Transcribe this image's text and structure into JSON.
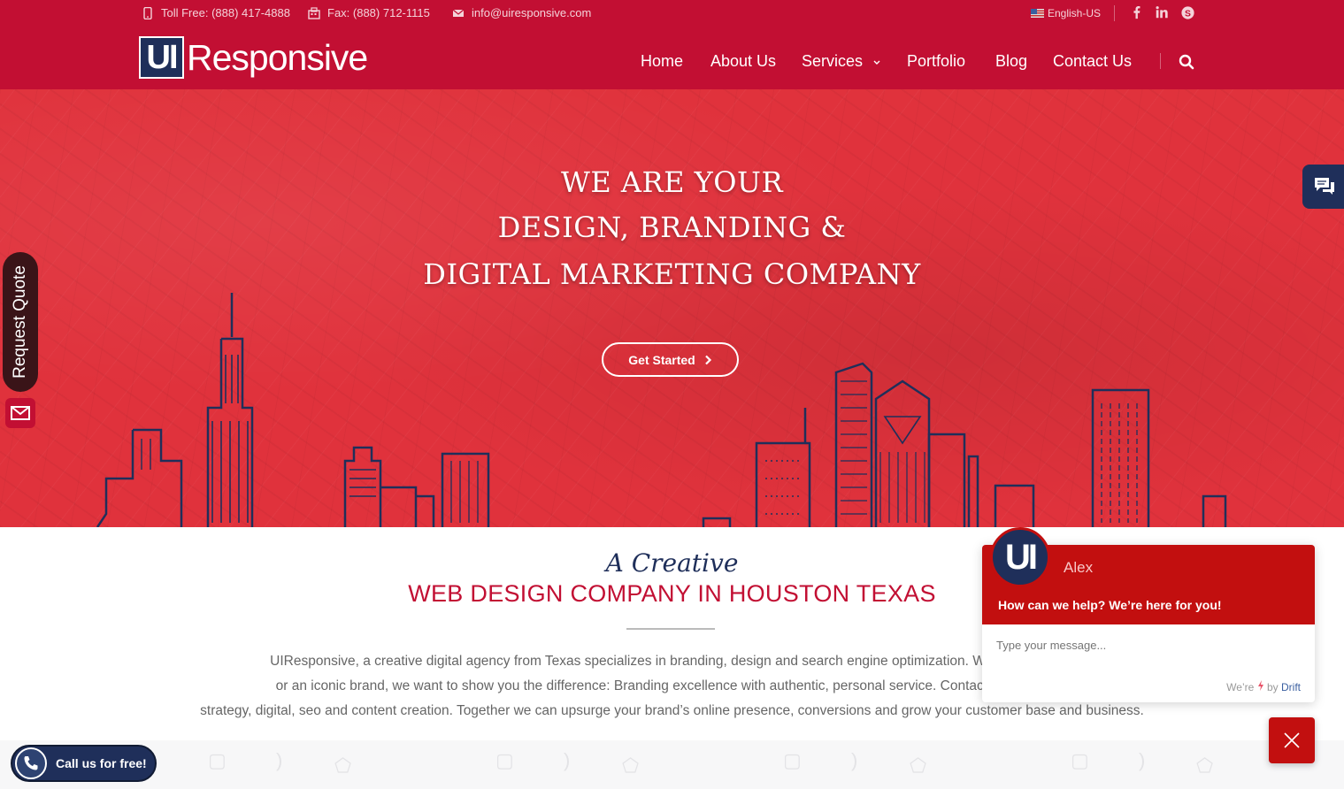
{
  "topbar": {
    "toll_free": "Toll Free: (888) 417-4888",
    "fax": "Fax: (888) 712-1115",
    "email": "info@uiresponsive.com",
    "language": "English-US"
  },
  "logo": {
    "mark": "UI",
    "text": "Responsive"
  },
  "nav": {
    "items": [
      "Home",
      "About Us",
      "Services",
      "Portfolio",
      "Blog",
      "Contact Us"
    ]
  },
  "hero": {
    "line1": "WE ARE YOUR",
    "line2": "DESIGN, BRANDING &",
    "line3": "DIGITAL MARKETING COMPANY",
    "cta": "Get Started"
  },
  "side": {
    "request_quote": "Request Quote"
  },
  "intro": {
    "heading_italic": "A Creative",
    "heading_main": "WEB DESIGN COMPANY IN HOUSTON TEXAS",
    "lines": [
      "UIResponsive, a creative digital agency from Texas specializes in branding, design and search engine optimization. Whether you are",
      "or an iconic brand, we want to show you the difference: Branding excellence with authentic, personal service. Contact our team tod",
      "strategy, digital, seo and content creation. Together we can upsurge your brand’s online presence, conversions and grow your customer base and business."
    ]
  },
  "call": {
    "label": "Call us for free!"
  },
  "drift": {
    "avatar": "UI",
    "agent_name": "Alex",
    "welcome": "How can we help? We’re here for you!",
    "placeholder": "Type your message...",
    "footer_prefix": "We’re",
    "footer_by": "by",
    "footer_brand": "Drift"
  },
  "colors": {
    "brand_red": "#c20f33",
    "navy": "#1f2f5a",
    "hero_red": "#e0323c"
  }
}
